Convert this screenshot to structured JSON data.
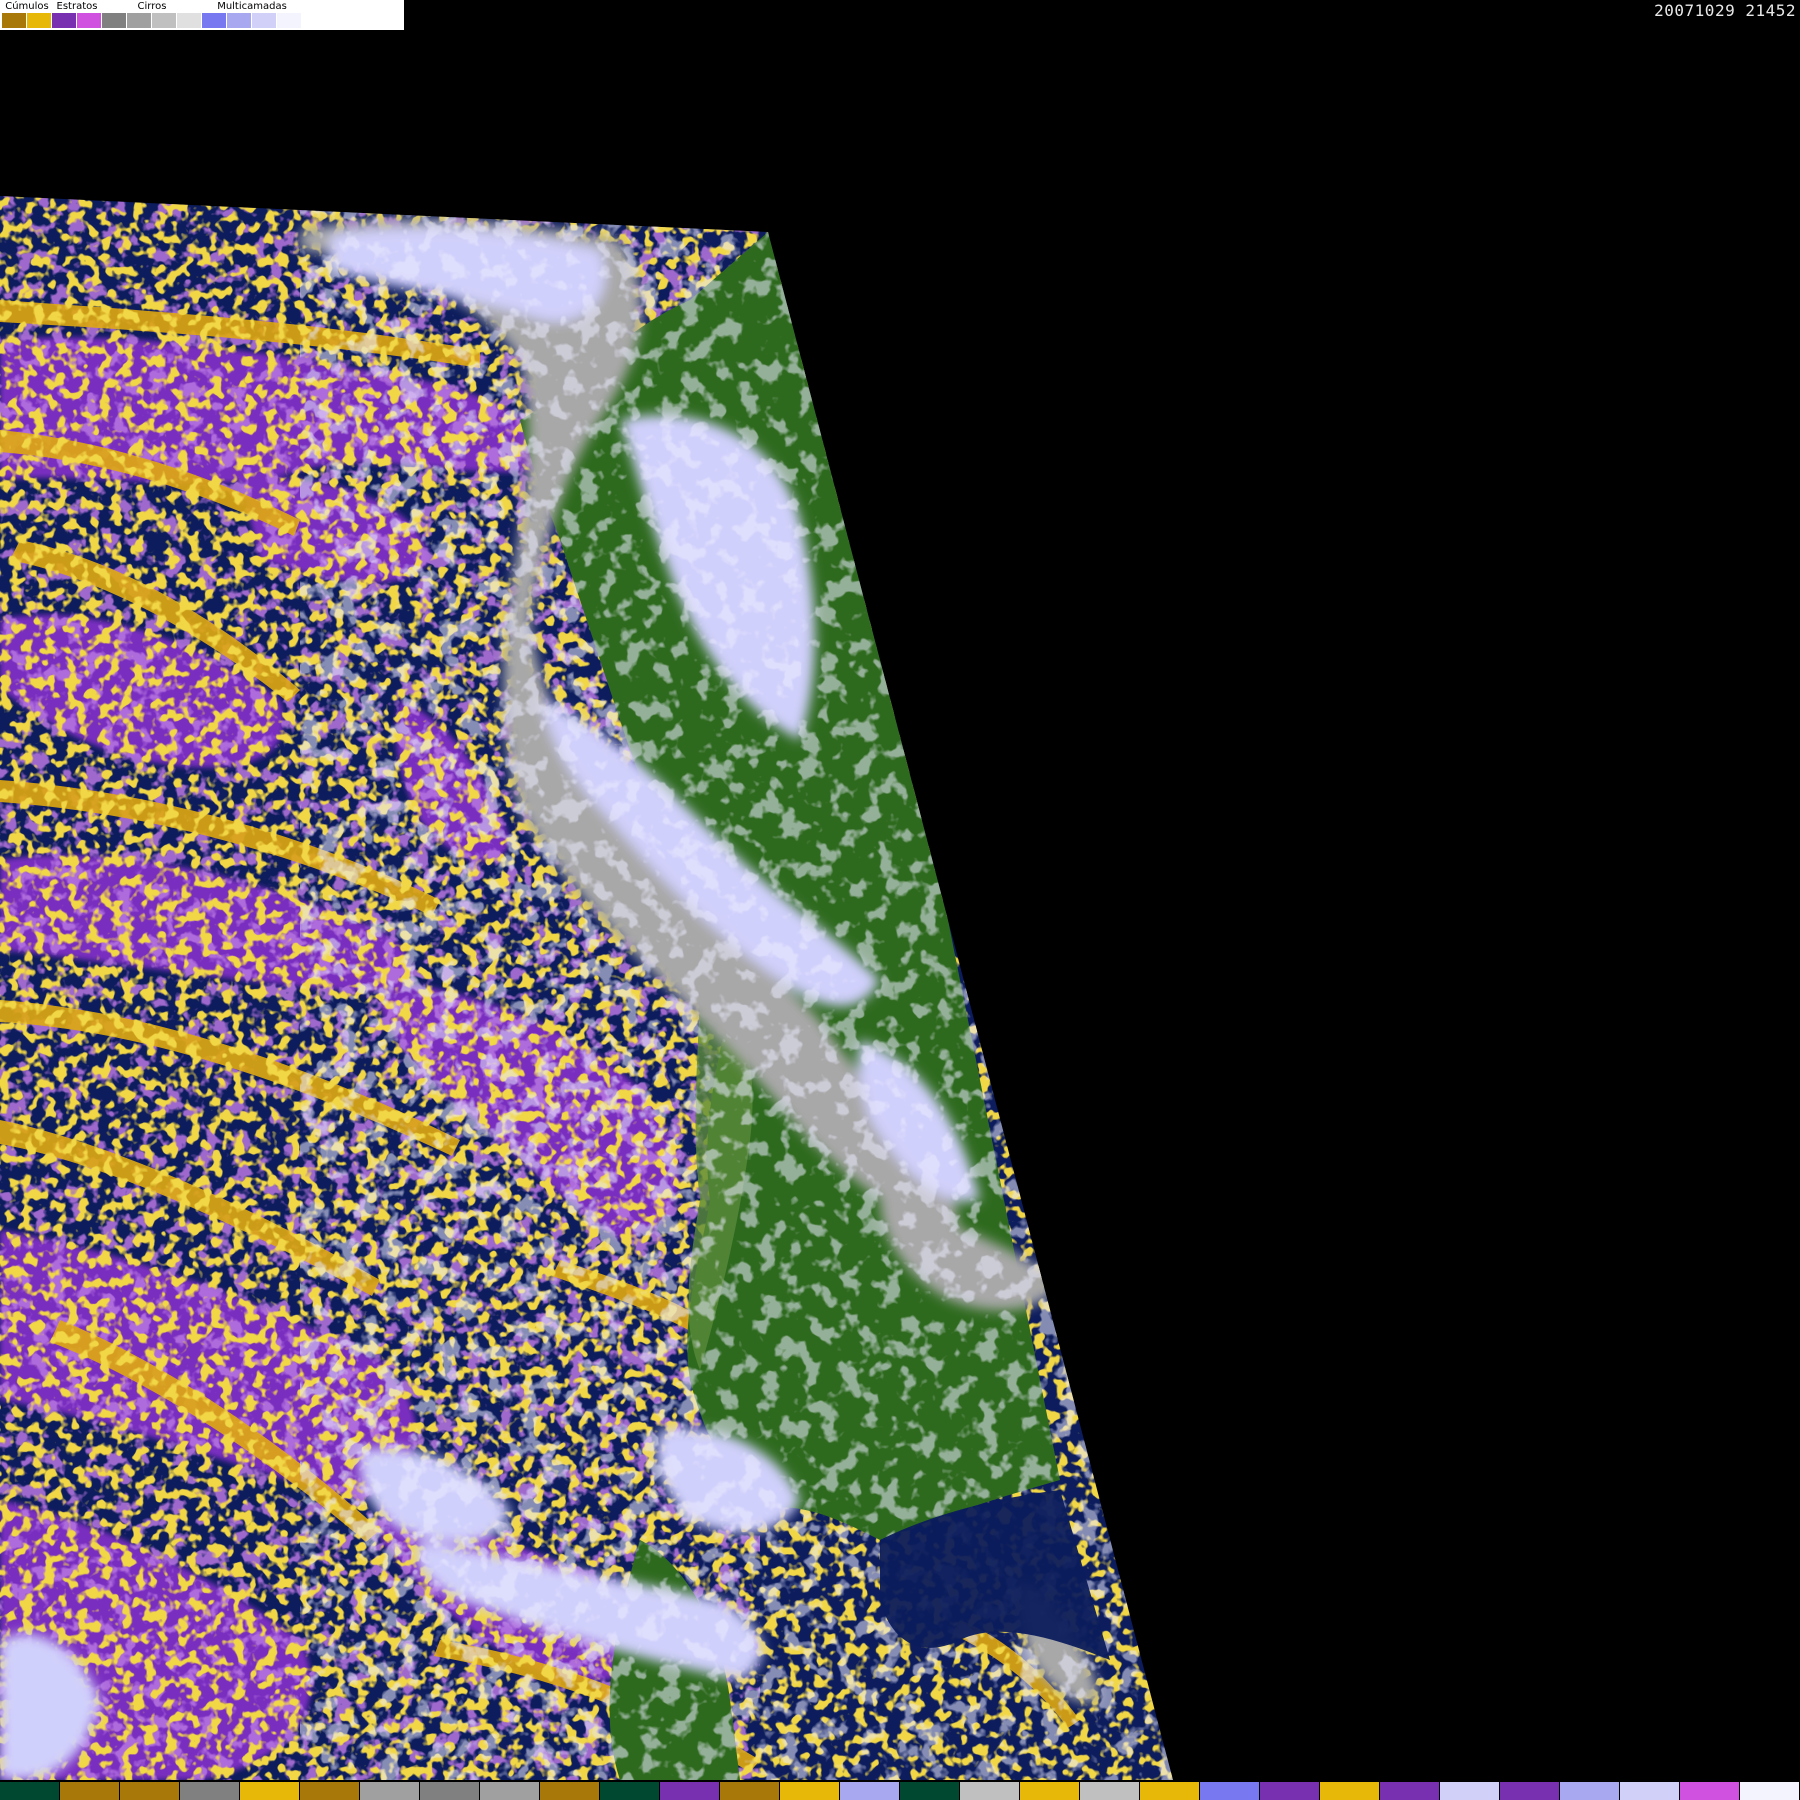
{
  "timestamp": "20071029 21452",
  "legend": {
    "groups": [
      {
        "label": "Cúmulos",
        "swatches": [
          "#a87808",
          "#e8b808"
        ]
      },
      {
        "label": "Estratos",
        "swatches": [
          "#7830b0",
          "#d050e0"
        ]
      },
      {
        "label": "Cirros",
        "swatches": [
          "#808080",
          "#a0a0a0",
          "#c0c0c0",
          "#e0e0e0"
        ]
      },
      {
        "label": "Multicamadas",
        "swatches": [
          "#7878f0",
          "#a8a8f0",
          "#d0d0f8",
          "#f4f4ff"
        ]
      }
    ]
  },
  "map_colors": {
    "background": "#000000",
    "ocean": "#0c1c5c",
    "land": "#2e6a1e",
    "land_light": "#5a8a3a",
    "cumulus": "#e0aa10",
    "stratus": "#7a2ec0",
    "stratus_light": "#c050e0",
    "cirrus": "#a8a8a8",
    "multilayer": "#a8a8f4",
    "multilayer_light": "#d0d0fc"
  },
  "bottom_strip": [
    "#004830",
    "#a87808",
    "#a87808",
    "#808080",
    "#e8b808",
    "#a87808",
    "#a0a0a0",
    "#808080",
    "#a0a0a0",
    "#a87808",
    "#004830",
    "#7830b0",
    "#a87808",
    "#e8b808",
    "#a8a8f0",
    "#004830",
    "#c0c0c0",
    "#e8b808",
    "#c0c0c0",
    "#e8b808",
    "#7878f0",
    "#7830b0",
    "#e8b808",
    "#7830b0",
    "#d0d0f8",
    "#7830b0",
    "#a8a8f0",
    "#d0d0f8",
    "#d050e0",
    "#f4f4ff"
  ]
}
